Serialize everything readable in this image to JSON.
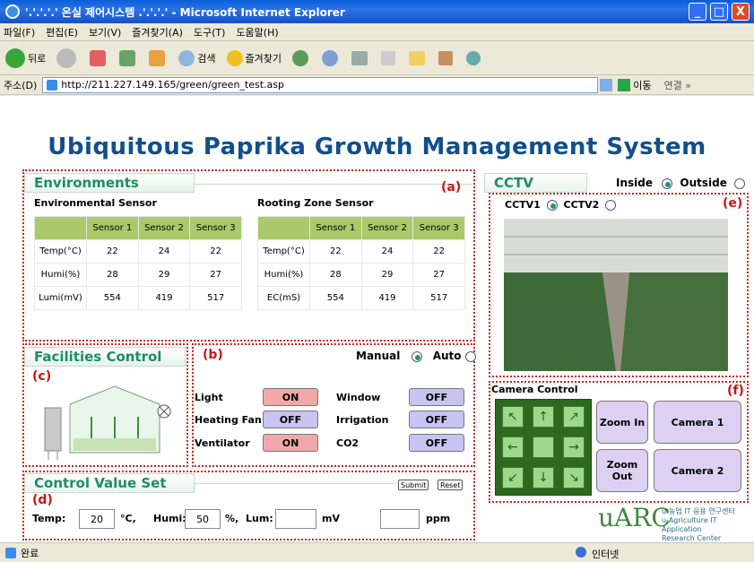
{
  "window": {
    "title": "'.'.'.'.' 온실 제어시스템 .'.'.'.'  - Microsoft Internet Explorer",
    "min": "_",
    "max": "□",
    "close": "X"
  },
  "menu": [
    "파일(F)",
    "편집(E)",
    "보기(V)",
    "즐겨찾기(A)",
    "도구(T)",
    "도움말(H)"
  ],
  "toolbar": {
    "back": "뒤로",
    "search": "검색",
    "favorites": "즐겨찾기"
  },
  "address": {
    "label": "주소(D)",
    "url": "http://211.227.149.165/green/green_test.asp",
    "go": "이동",
    "links": "연결 »"
  },
  "page": {
    "title": "Ubiquitous Paprika Growth Management System"
  },
  "environments": {
    "heading": "Environments",
    "tag": "(a)",
    "env_title": "Environmental Sensor",
    "root_title": "Rooting Zone Sensor",
    "columns": [
      "Sensor 1",
      "Sensor 2",
      "Sensor 3"
    ],
    "env_rows": [
      {
        "label": "Temp(°C)",
        "values": [
          "22",
          "24",
          "22"
        ]
      },
      {
        "label": "Humi(%)",
        "values": [
          "28",
          "29",
          "27"
        ]
      },
      {
        "label": "Lumi(mV)",
        "values": [
          "554",
          "419",
          "517"
        ]
      }
    ],
    "root_rows": [
      {
        "label": "Temp(°C)",
        "values": [
          "22",
          "24",
          "22"
        ]
      },
      {
        "label": "Humi(%)",
        "values": [
          "28",
          "29",
          "27"
        ]
      },
      {
        "label": "EC(mS)",
        "values": [
          "554",
          "419",
          "517"
        ]
      }
    ]
  },
  "facilities": {
    "heading": "Facilities Control",
    "tag_c": "(c)",
    "tag_b": "(b)",
    "manual": "Manual",
    "auto": "Auto",
    "left": [
      {
        "label": "Light",
        "state": "ON"
      },
      {
        "label": "Heating Fan",
        "state": "OFF"
      },
      {
        "label": "Ventilator",
        "state": "ON"
      }
    ],
    "right": [
      {
        "label": "Window",
        "state": "OFF"
      },
      {
        "label": "Irrigation",
        "state": "OFF"
      },
      {
        "label": "CO2",
        "state": "OFF"
      }
    ]
  },
  "cctv": {
    "heading": "CCTV",
    "inside": "Inside",
    "outside": "Outside",
    "cctv1": "CCTV1",
    "cctv2": "CCTV2",
    "tag": "(e)"
  },
  "camera": {
    "heading": "Camera Control",
    "tag": "(f)",
    "zoom_in": "Zoom In",
    "zoom_out": "Zoom Out",
    "camera1": "Camera 1",
    "camera2": "Camera 2"
  },
  "control": {
    "heading": "Control Value Set",
    "tag": "(d)",
    "submit": "Submit",
    "reset": "Reset",
    "temp_label": "Temp:",
    "temp": "20",
    "temp_unit": "°C,",
    "humi_label": "Humi:",
    "humi": "50",
    "humi_unit": "%,",
    "lum_label": "Lum:",
    "lum": "",
    "lum_unit": "mV",
    "ppm": "",
    "ppm_unit": "ppm"
  },
  "logo": {
    "text": "uARC",
    "line1": "u-농업 IT 응용 연구센터",
    "line2": "u-Agriculture IT Application",
    "line3": "Research Center"
  },
  "status": {
    "left": "완료",
    "right": "인터넷"
  }
}
